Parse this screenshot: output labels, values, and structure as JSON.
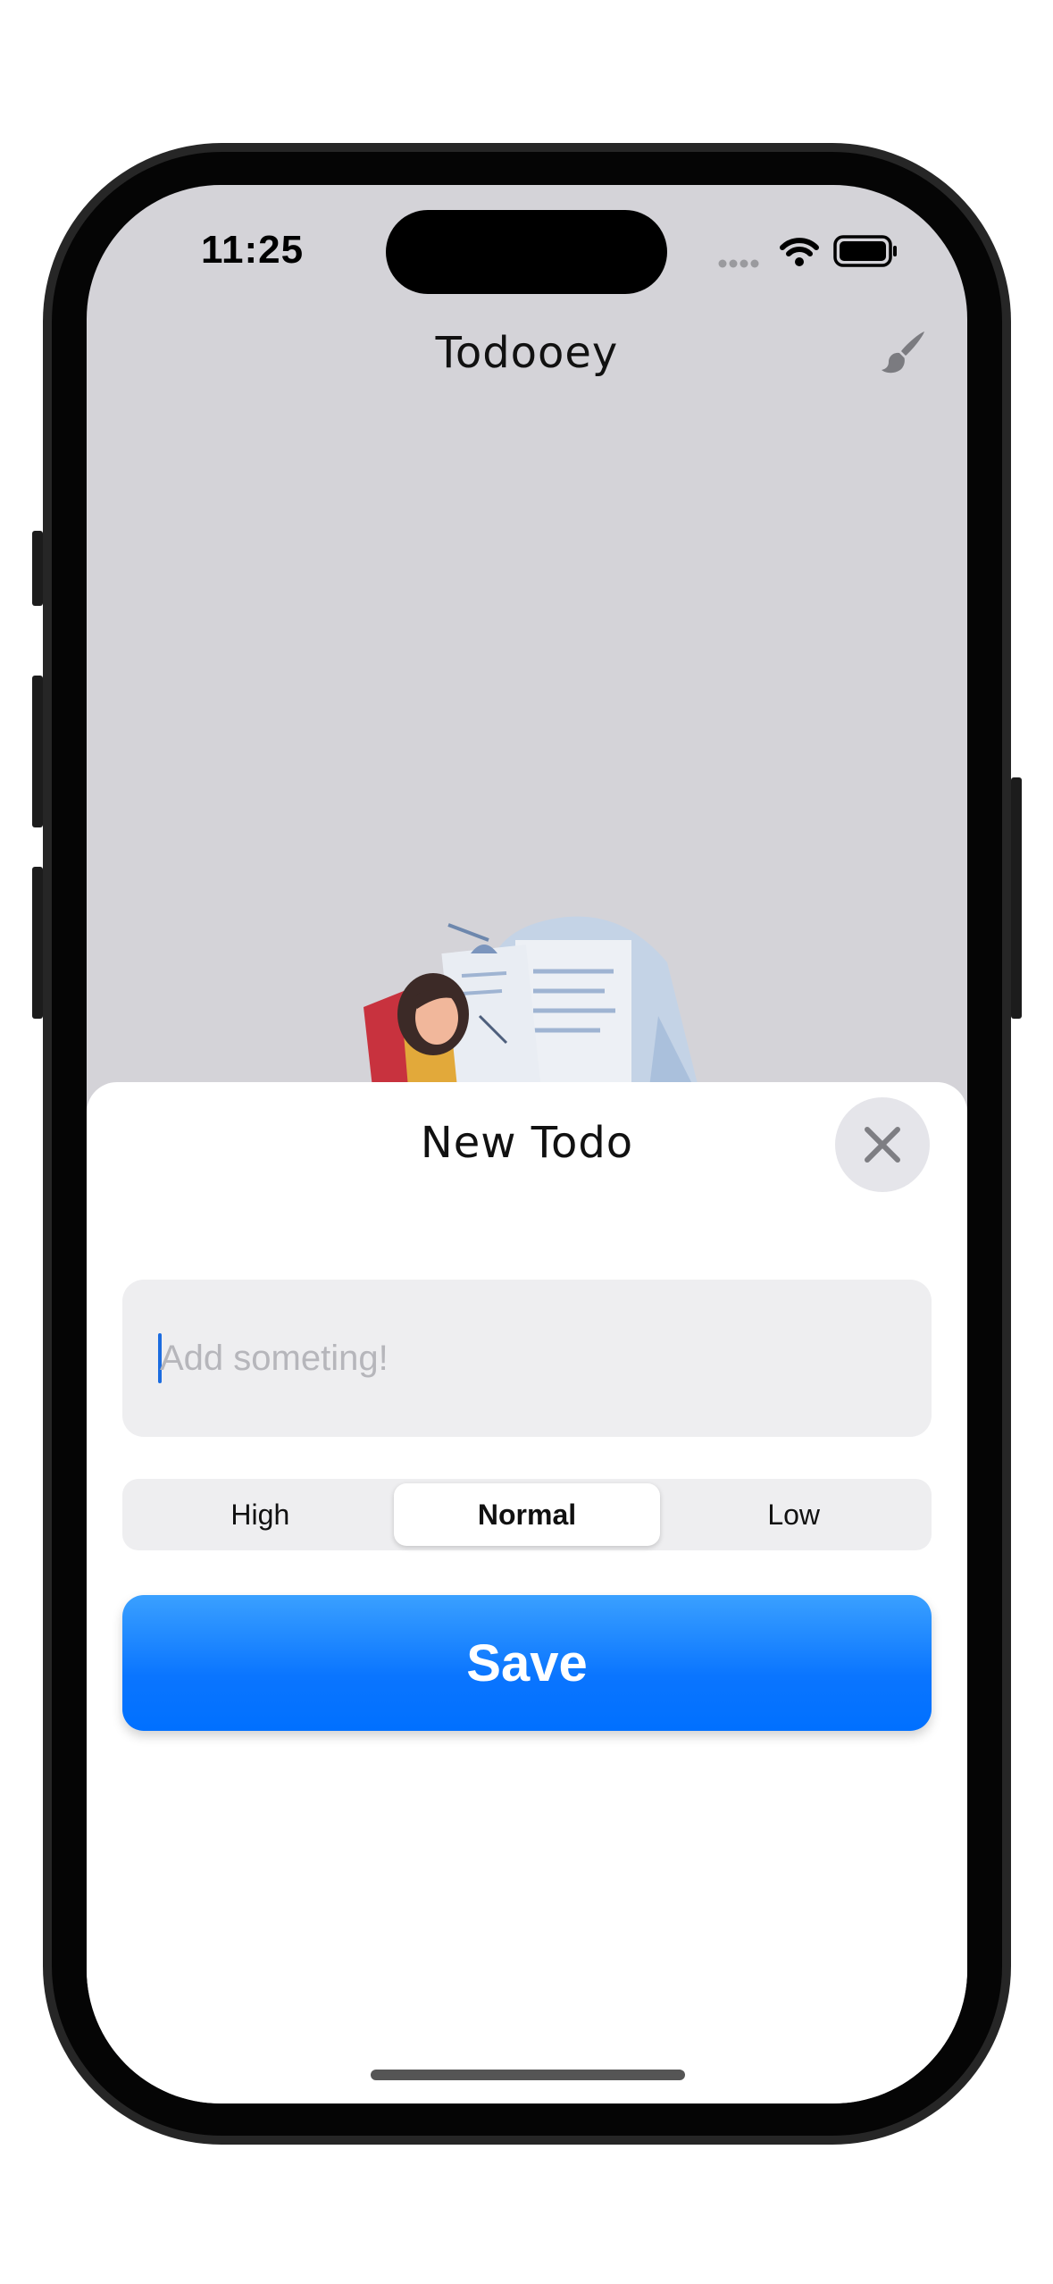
{
  "status_bar": {
    "time": "11:25",
    "signal_icon": "cellular-dots-icon",
    "wifi_icon": "wifi-icon",
    "battery_icon": "battery-full-icon"
  },
  "nav": {
    "title": "Todooey",
    "theme_button_icon": "paintbrush-icon"
  },
  "illustration": {
    "icon": "woman-reading-illustration"
  },
  "sheet": {
    "title": "New Todo",
    "close_icon": "close-icon",
    "input": {
      "placeholder": "Add someting!",
      "value": ""
    },
    "priority": {
      "options": [
        "High",
        "Normal",
        "Low"
      ],
      "selected": "Normal"
    },
    "save_label": "Save"
  },
  "colors": {
    "accent": "#007AFF",
    "screen_background": "#D4D3D8",
    "sheet_background": "#FFFFFF",
    "field_background": "#EEEEF0"
  }
}
